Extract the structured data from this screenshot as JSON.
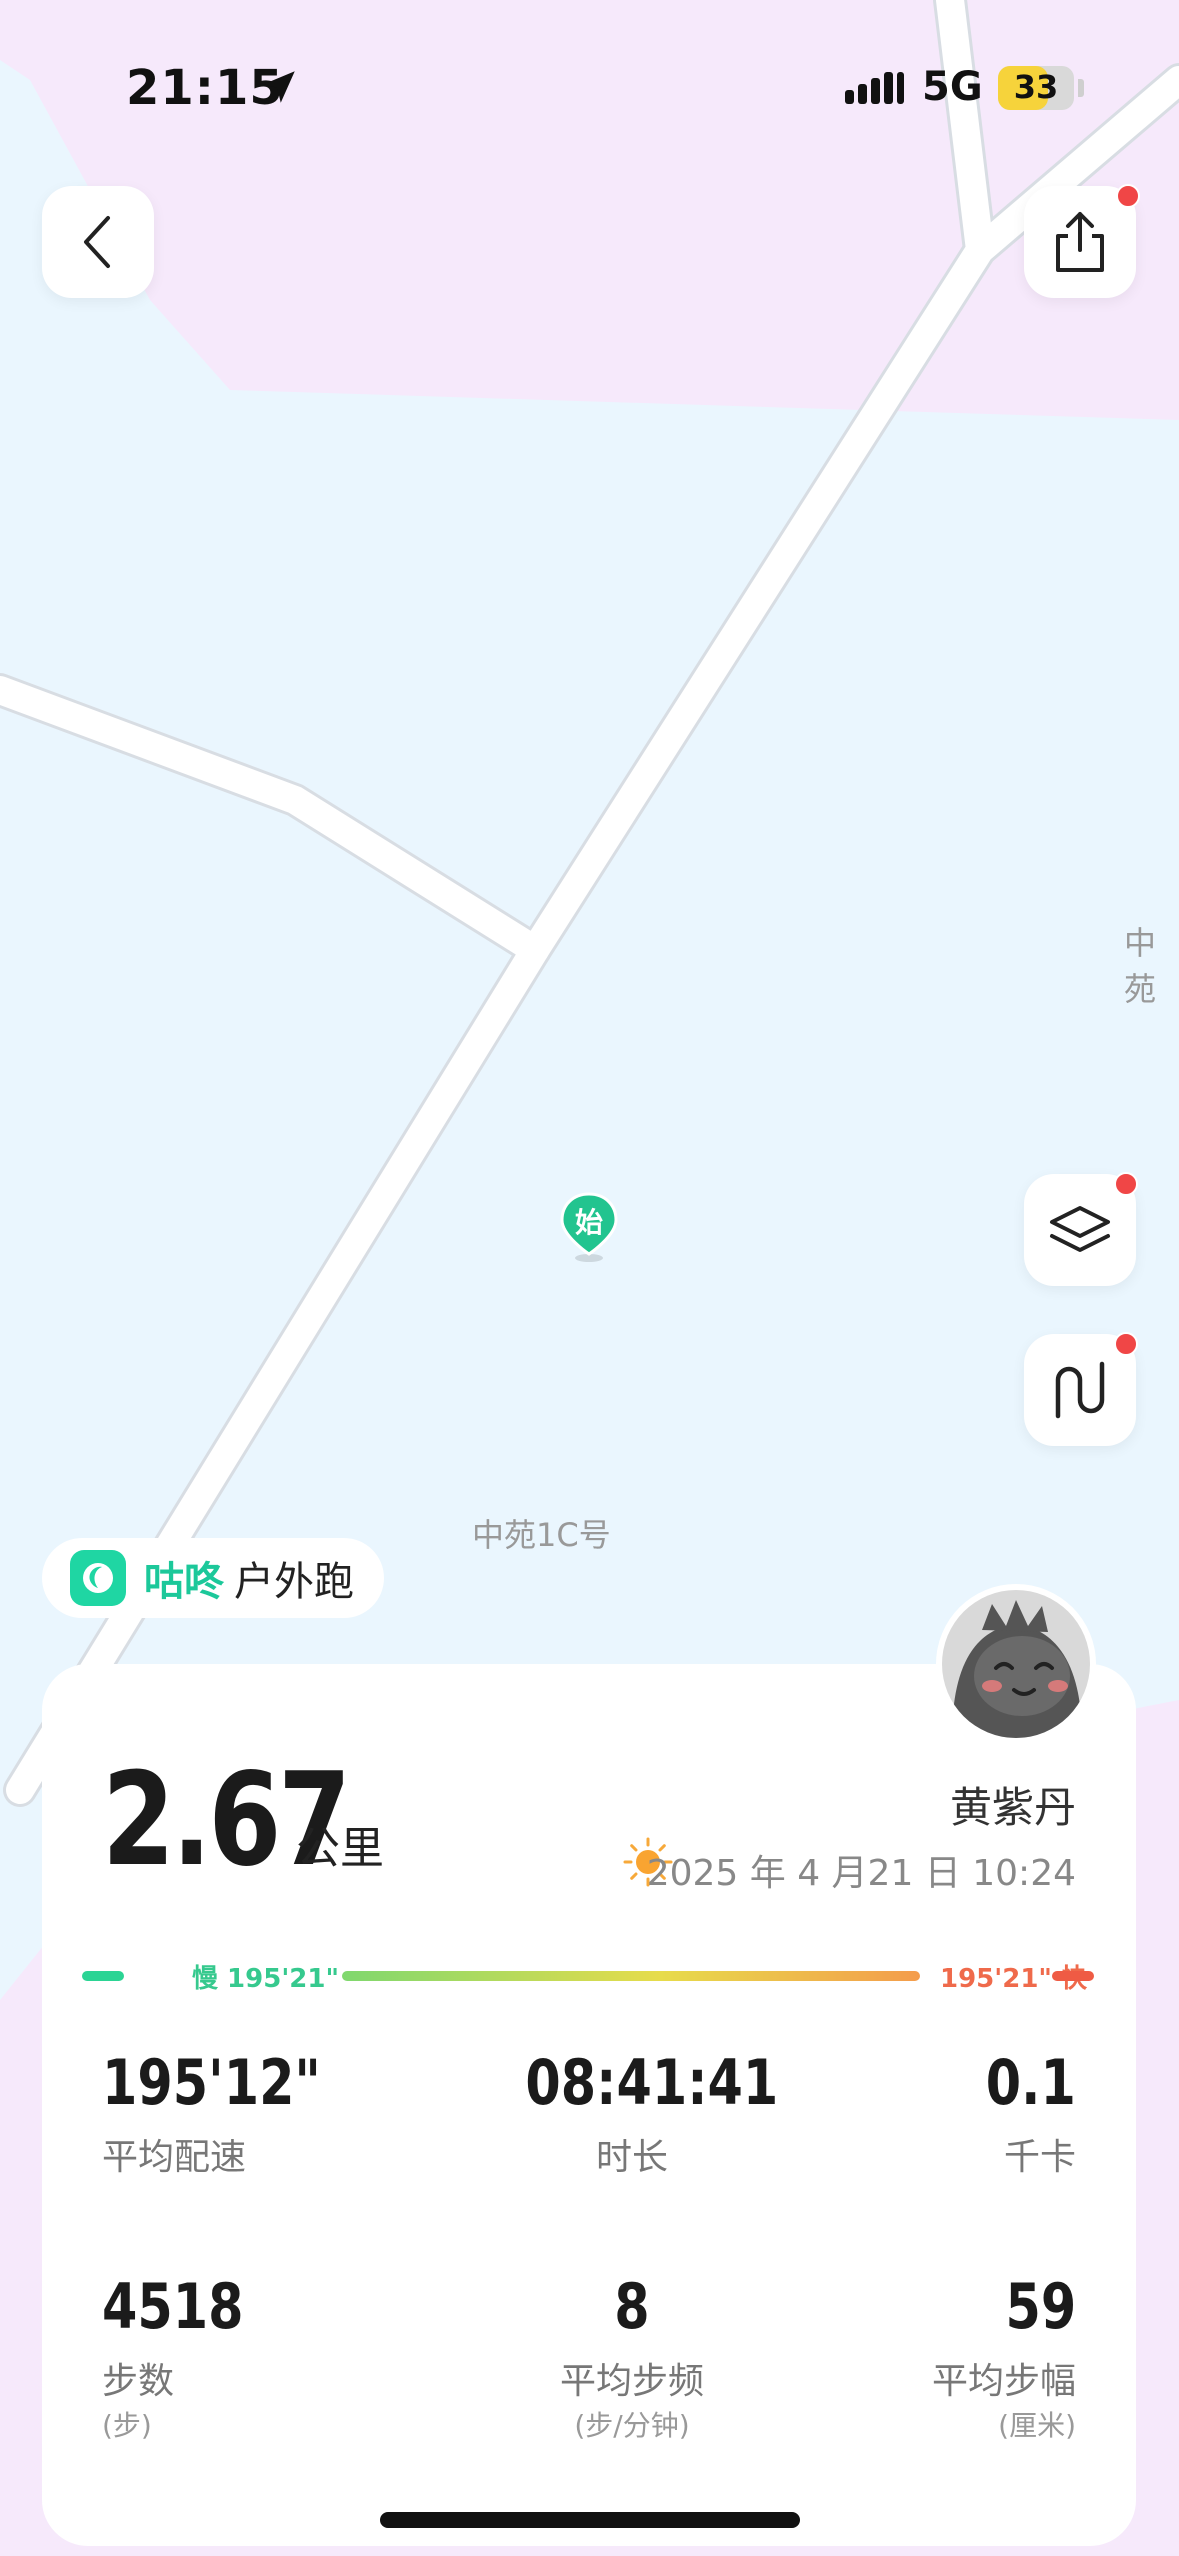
{
  "status_bar": {
    "time": "21:15",
    "network": "5G",
    "battery": "33",
    "battery_level": 0.33
  },
  "icons": {
    "back": "chevron-left-icon",
    "share": "share-icon",
    "layers": "layers-icon",
    "route": "route-icon",
    "location": "location-arrow-icon",
    "weather": "sun-icon"
  },
  "map": {
    "start_marker": "始",
    "labels": [
      "中苑",
      "中苑1C号"
    ]
  },
  "app_badge": {
    "app_name": "咕咚",
    "activity": "户外跑"
  },
  "summary": {
    "distance": "2.67",
    "distance_unit": "公里",
    "user_name": "黄紫丹",
    "datetime": "2025 年 4 月21 日 10:24"
  },
  "pace_bar": {
    "slow_label": "慢 195'21\"",
    "fast_label": "195'21\" 快"
  },
  "stats": [
    {
      "value": "195'12\"",
      "label": "平均配速",
      "sub": ""
    },
    {
      "value": "08:41:41",
      "label": "时长",
      "sub": ""
    },
    {
      "value": "0.1",
      "label": "千卡",
      "sub": ""
    },
    {
      "value": "4518",
      "label": "步数",
      "sub": "(步)"
    },
    {
      "value": "8",
      "label": "平均步频",
      "sub": "(步/分钟)"
    },
    {
      "value": "59",
      "label": "平均步幅",
      "sub": "(厘米)"
    }
  ],
  "colors": {
    "accent": "#1cc89a",
    "slow": "#2bd494",
    "fast": "#ef5b44",
    "map_water": "#eaf6fe",
    "map_area": "#f6e9fb"
  }
}
